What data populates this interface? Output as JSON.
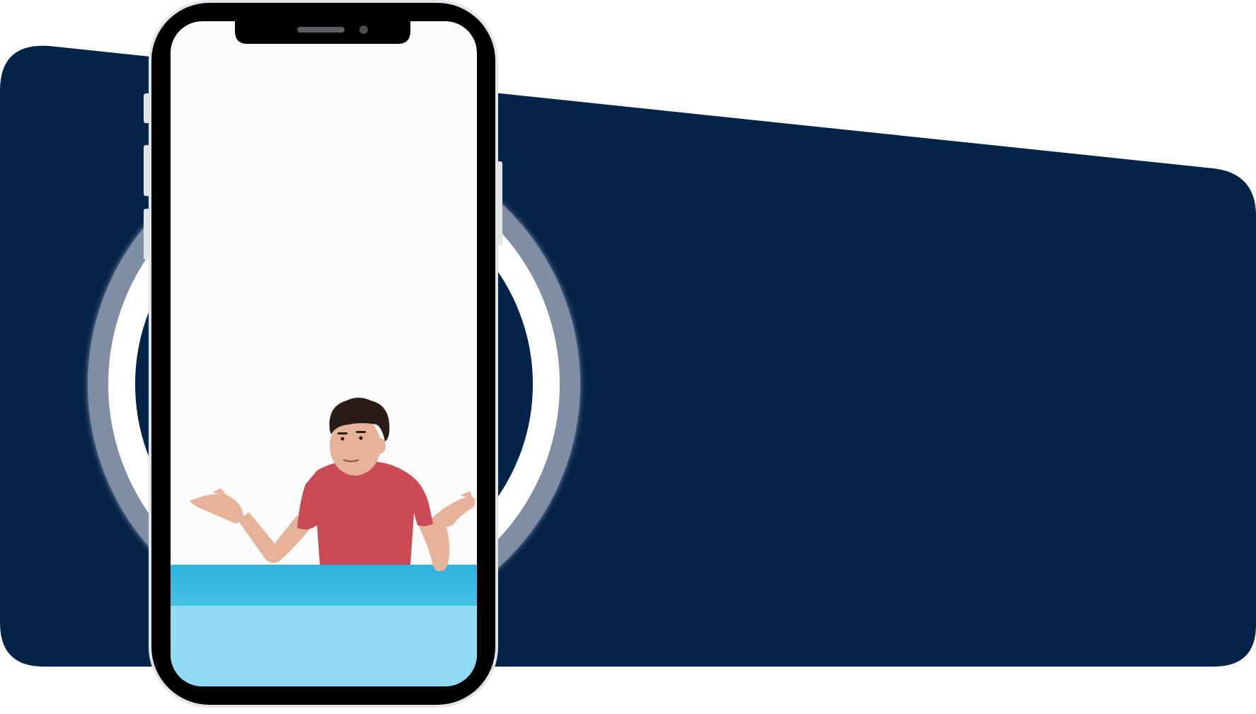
{
  "colors": {
    "page_background": "#ffffff",
    "banner": "#032348",
    "ring": "#7f8ea3",
    "ring_glow": "#c9d1dc",
    "phone_frame": "#000000",
    "phone_bezel": "#e2e4e8",
    "screen_background": "#fbfbfb",
    "table_top": "#3ab8e0",
    "table_front": "#8fdcf4",
    "shirt": "#c84b55",
    "skin": "#e6b39a",
    "hair": "#2a1d17"
  },
  "icons": {
    "phone": "smartphone-icon",
    "ring": "ring-icon"
  },
  "phone": {
    "notch": "notch",
    "speaker": "speaker-grille",
    "camera": "front-camera"
  },
  "scene": {
    "subject": "person-shrugging",
    "surface": "table"
  }
}
